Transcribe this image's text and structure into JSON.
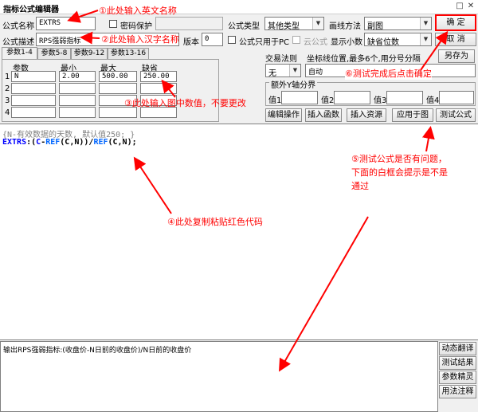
{
  "window": {
    "title": "指标公式编辑器"
  },
  "form": {
    "name_label": "公式名称",
    "name_value": "EXTRS",
    "password_label": "密码保护",
    "desc_label": "公式描述",
    "desc_value": "RPS强弱指标",
    "version_label": "版本",
    "version_value": "0",
    "type_label": "公式类型",
    "type_value": "其他类型",
    "draw_label": "画线方法",
    "draw_value": "副图",
    "pc_only_label": "公式只用于PC",
    "cloud_label": "云公式",
    "decimals_label": "显示小数",
    "decimals_value": "缺省位数"
  },
  "buttons": {
    "ok": "确  定",
    "cancel": "取  消",
    "save_as": "另存为",
    "edit_op": "编辑操作",
    "insert_fn": "插入函数",
    "insert_res": "插入资源",
    "apply": "应用于图",
    "test": "测试公式"
  },
  "tabs": [
    "参数1-4",
    "参数5-8",
    "参数9-12",
    "参数13-16"
  ],
  "params": {
    "headers": [
      "参数",
      "最小",
      "最大",
      "缺省"
    ],
    "rows": [
      {
        "idx": "1",
        "name": "N",
        "min": "2.00",
        "max": "500.00",
        "def": "250.00"
      },
      {
        "idx": "2",
        "name": "",
        "min": "",
        "max": "",
        "def": ""
      },
      {
        "idx": "3",
        "name": "",
        "min": "",
        "max": "",
        "def": ""
      },
      {
        "idx": "4",
        "name": "",
        "min": "",
        "max": "",
        "def": ""
      }
    ]
  },
  "trade": {
    "label": "交易法则",
    "value": "无"
  },
  "coord": {
    "label": "坐标线位置,最多6个,用分号分隔",
    "value": "自动"
  },
  "yaxis": {
    "title": "额外Y轴分界",
    "labels": [
      "值1",
      "值2",
      "值3",
      "值4"
    ]
  },
  "editor": {
    "comment": "{N-有效数据的天数, 默认值250; }",
    "code_name": "EXTRS",
    "code_op": ":(",
    "code_c": "C",
    "code_minus": "-",
    "code_ref1": "REF",
    "code_args1": "(C,N))/",
    "code_ref2": "REF",
    "code_args2": "(C,N);"
  },
  "output": {
    "text": "输出RPS强弱指标:(收盘价-N日前的收盘价)/N日前的收盘价"
  },
  "side_buttons": [
    "动态翻译",
    "测试结果",
    "参数精灵",
    "用法注释"
  ],
  "annotations": {
    "a1": "①此处输入英文名称",
    "a2": "②此处输入汉字名称",
    "a3": "③此处输入图中数值，不要更改",
    "a4": "④此处复制粘贴红色代码",
    "a5_line1": "⑤测试公式是否有问题，",
    "a5_line2": "下面的白框会提示是不是",
    "a5_line3": "通过",
    "a6": "⑥测试完成后点击确定"
  },
  "colors": {
    "annotation": "#ff0000",
    "keyword": "#0000ff"
  }
}
